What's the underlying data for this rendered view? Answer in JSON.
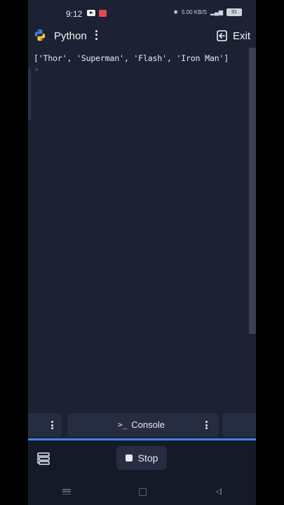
{
  "status_bar": {
    "time": "9:12",
    "network_speed": "5.00 KB/S",
    "battery": "91"
  },
  "header": {
    "title": "Python",
    "exit_label": "Exit"
  },
  "console": {
    "output": "['Thor', 'Superman', 'Flash', 'Iron Man']",
    "prompt_symbol": ">"
  },
  "tabs": {
    "console_label": "Console",
    "console_glyph": ">_"
  },
  "bottom": {
    "stop_label": "Stop"
  },
  "colors": {
    "background": "#1c2233",
    "accent": "#3f86e0",
    "panel": "#262d40"
  }
}
